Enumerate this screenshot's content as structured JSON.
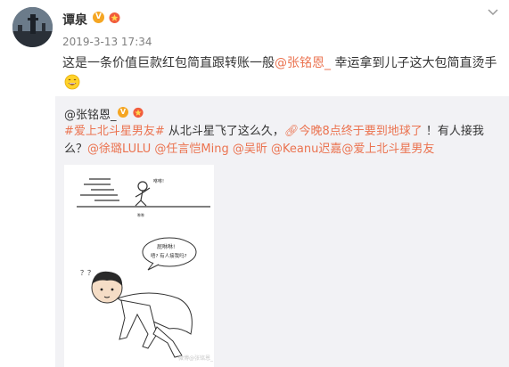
{
  "author": {
    "name": "谭泉",
    "v_badge": "V",
    "timestamp": "2019-3-13 17:34"
  },
  "post": {
    "text_before": "这是一条价值巨款红包简直跟转账一般",
    "mention": "@张铭恩_",
    "text_after": " 幸运拿到儿子这大包简直烫手"
  },
  "repost": {
    "author": "@张铭恩_",
    "v_badge": "V",
    "hashtag": "#爱上北斗星男友#",
    "text1": " 从北斗星飞了这么久，",
    "link": "今晚8点终于要到地球了",
    "text2": " ！有人接我么？",
    "mentions": [
      "@徐璐LULU",
      "@任言恺Ming",
      "@吴昕",
      "@Keanu迟嘉",
      "@爱上北斗星男友"
    ],
    "image": {
      "caption_top": "咻咻!",
      "caption_small": "咻咻",
      "question": "？？",
      "bubble_line1": "屁咻咻!",
      "bubble_line2": "唔? 有人接我吗?",
      "watermark": "微博@张铭恩_"
    }
  },
  "colors": {
    "link": "#eb7350",
    "meta": "#808080",
    "repost_bg": "#f2f2f5"
  }
}
